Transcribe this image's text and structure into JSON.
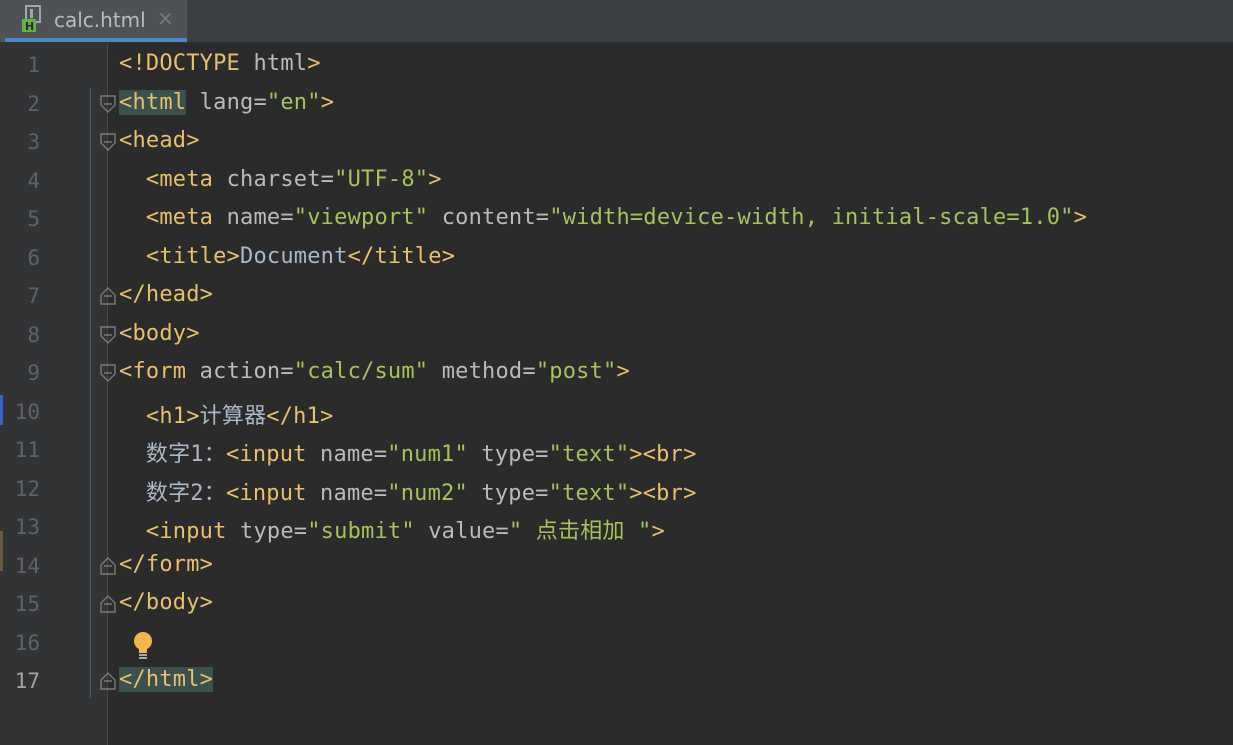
{
  "tab": {
    "label": "calc.html",
    "close": "×",
    "icon": "html-file-icon"
  },
  "colors": {
    "background": "#2b2b2b",
    "tag": "#e8bf6a",
    "attr": "#bababa",
    "string": "#a5c25c",
    "text": "#a9b7c6",
    "line_number": "#606366"
  },
  "current_line": 17,
  "lines": [
    {
      "n": "1",
      "tokens": [
        [
          "tag",
          "<!DOCTYPE "
        ],
        [
          "attr",
          "html"
        ],
        [
          "tag",
          ">"
        ]
      ]
    },
    {
      "n": "2",
      "tokens": [
        [
          "tag",
          "<html"
        ],
        [
          "attr",
          " lang="
        ],
        [
          "str",
          "\"en\""
        ],
        [
          "tag",
          ">"
        ]
      ]
    },
    {
      "n": "3",
      "tokens": [
        [
          "tag",
          "<head>"
        ]
      ]
    },
    {
      "n": "4",
      "tokens": [
        [
          "tag",
          "  <meta"
        ],
        [
          "attr",
          " charset="
        ],
        [
          "str",
          "\"UTF-8\""
        ],
        [
          "tag",
          ">"
        ]
      ]
    },
    {
      "n": "5",
      "tokens": [
        [
          "tag",
          "  <meta"
        ],
        [
          "attr",
          " name="
        ],
        [
          "str",
          "\"viewport\""
        ],
        [
          "attr",
          " content="
        ],
        [
          "str",
          "\"width=device-width, initial-scale=1.0\""
        ],
        [
          "tag",
          ">"
        ]
      ]
    },
    {
      "n": "6",
      "tokens": [
        [
          "tag",
          "  <title>"
        ],
        [
          "text",
          "Document"
        ],
        [
          "tag",
          "</title>"
        ]
      ]
    },
    {
      "n": "7",
      "tokens": [
        [
          "tag",
          "</head>"
        ]
      ]
    },
    {
      "n": "8",
      "tokens": [
        [
          "tag",
          "<body>"
        ]
      ]
    },
    {
      "n": "9",
      "tokens": [
        [
          "tag",
          "<form"
        ],
        [
          "attr",
          " action="
        ],
        [
          "str",
          "\"calc/sum\""
        ],
        [
          "attr",
          " method="
        ],
        [
          "str",
          "\"post\""
        ],
        [
          "tag",
          ">"
        ]
      ]
    },
    {
      "n": "10",
      "tokens": [
        [
          "tag",
          "  <h1>"
        ],
        [
          "text",
          "计算器"
        ],
        [
          "tag",
          "</h1>"
        ]
      ]
    },
    {
      "n": "11",
      "tokens": [
        [
          "text",
          "  数字1："
        ],
        [
          "tag",
          "<input"
        ],
        [
          "attr",
          " name="
        ],
        [
          "str",
          "\"num1\""
        ],
        [
          "attr",
          " type="
        ],
        [
          "str",
          "\"text\""
        ],
        [
          "tag",
          "><br>"
        ]
      ]
    },
    {
      "n": "12",
      "tokens": [
        [
          "text",
          "  数字2："
        ],
        [
          "tag",
          "<input"
        ],
        [
          "attr",
          " name="
        ],
        [
          "str",
          "\"num2\""
        ],
        [
          "attr",
          " type="
        ],
        [
          "str",
          "\"text\""
        ],
        [
          "tag",
          "><br>"
        ]
      ]
    },
    {
      "n": "13",
      "tokens": [
        [
          "tag",
          "  <input"
        ],
        [
          "attr",
          " type="
        ],
        [
          "str",
          "\"submit\""
        ],
        [
          "attr",
          " value="
        ],
        [
          "str",
          "\" 点击相加 \""
        ],
        [
          "tag",
          ">"
        ]
      ]
    },
    {
      "n": "14",
      "tokens": [
        [
          "tag",
          "</form>"
        ]
      ]
    },
    {
      "n": "15",
      "tokens": [
        [
          "tag",
          "</body>"
        ]
      ]
    },
    {
      "n": "16",
      "tokens": []
    },
    {
      "n": "17",
      "tokens": [
        [
          "tag",
          "</html>"
        ]
      ]
    }
  ],
  "bulb_icon": "lightbulb-icon"
}
